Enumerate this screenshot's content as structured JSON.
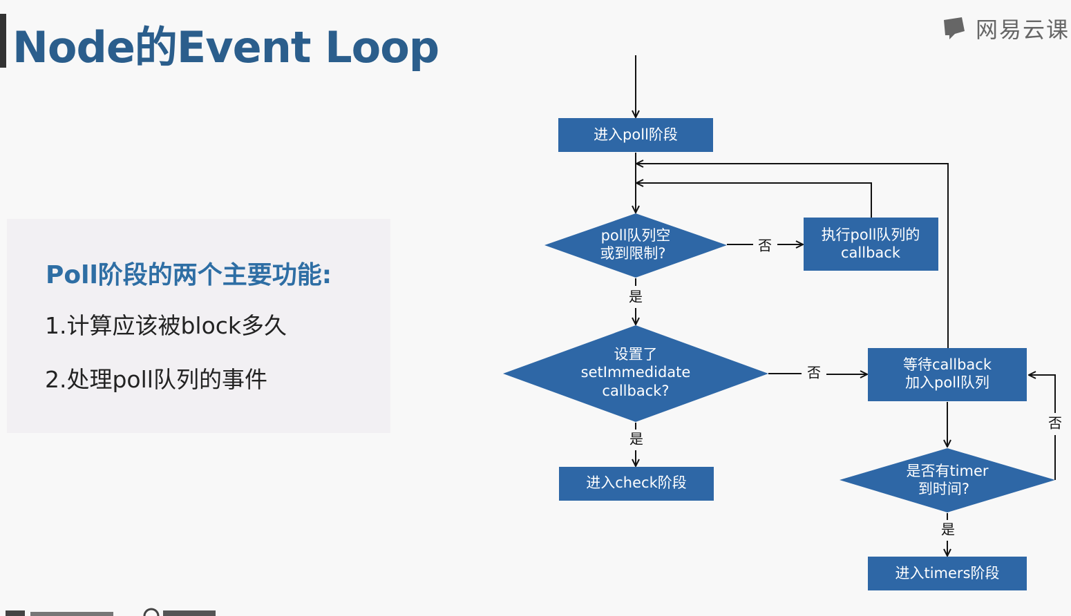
{
  "title": "Node的Event Loop",
  "brand": {
    "name": "网易云课"
  },
  "panel": {
    "heading": "Poll阶段的两个主要功能:",
    "items": [
      "1.计算应该被block多久",
      "2.处理poll队列的事件"
    ]
  },
  "flow": {
    "enter_poll": "进入poll阶段",
    "poll_empty_line1": "poll队列空",
    "poll_empty_line2": "或到限制?",
    "exec_line1": "执行poll队列的",
    "exec_line2": "callback",
    "set_immediate_line1": "设置了",
    "set_immediate_line2": "setImmedidate",
    "set_immediate_line3": "callback?",
    "wait_line1": "等待callback",
    "wait_line2": "加入poll队列",
    "enter_check": "进入check阶段",
    "timer_line1": "是否有timer",
    "timer_line2": "到时间?",
    "enter_timers": "进入timers阶段",
    "yes": "是",
    "no": "否"
  },
  "colors": {
    "box": "#2e67a6",
    "title": "#2b5e8c",
    "heading": "#2e6ea4"
  }
}
